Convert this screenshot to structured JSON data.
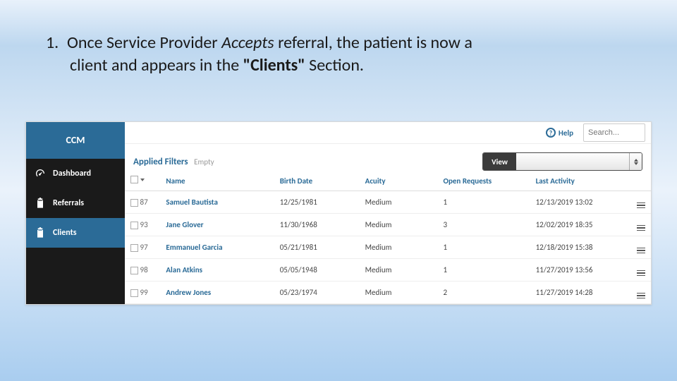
{
  "instruction": {
    "number": "1.",
    "text_before_accepts": "Once Service Provider ",
    "accepts": "Accepts",
    "text_after_accepts": " referral, the patient is now a",
    "line2_before": "client and appears in the ",
    "clients_word": "\"Clients\"",
    "line2_after": " Section."
  },
  "brand": "CCM",
  "sidebar": [
    {
      "label": "Dashboard",
      "icon": "gauge-icon",
      "active": false
    },
    {
      "label": "Referrals",
      "icon": "clipboard-icon",
      "active": false
    },
    {
      "label": "Clients",
      "icon": "clipboard-icon",
      "active": true
    }
  ],
  "topbar": {
    "help_label": "Help",
    "search_placeholder": "Search..."
  },
  "filters": {
    "label": "Applied Filters",
    "empty": "Empty",
    "view_label": "View"
  },
  "table": {
    "headers": {
      "name": "Name",
      "birth": "Birth Date",
      "acuity": "Acuity",
      "open": "Open Requests",
      "last": "Last Activity"
    },
    "rows": [
      {
        "id": "87",
        "name": "Samuel Bautista",
        "birth": "12/25/1981",
        "acuity": "Medium",
        "open": "1",
        "last": "12/13/2019 13:02"
      },
      {
        "id": "93",
        "name": "Jane Glover",
        "birth": "11/30/1968",
        "acuity": "Medium",
        "open": "3",
        "last": "12/02/2019 18:35"
      },
      {
        "id": "97",
        "name": "Emmanuel Garcia",
        "birth": "05/21/1981",
        "acuity": "Medium",
        "open": "1",
        "last": "12/18/2019 15:38"
      },
      {
        "id": "98",
        "name": "Alan Atkins",
        "birth": "05/05/1948",
        "acuity": "Medium",
        "open": "1",
        "last": "11/27/2019 13:56"
      },
      {
        "id": "99",
        "name": "Andrew Jones",
        "birth": "05/23/1974",
        "acuity": "Medium",
        "open": "2",
        "last": "11/27/2019 14:28"
      }
    ]
  }
}
